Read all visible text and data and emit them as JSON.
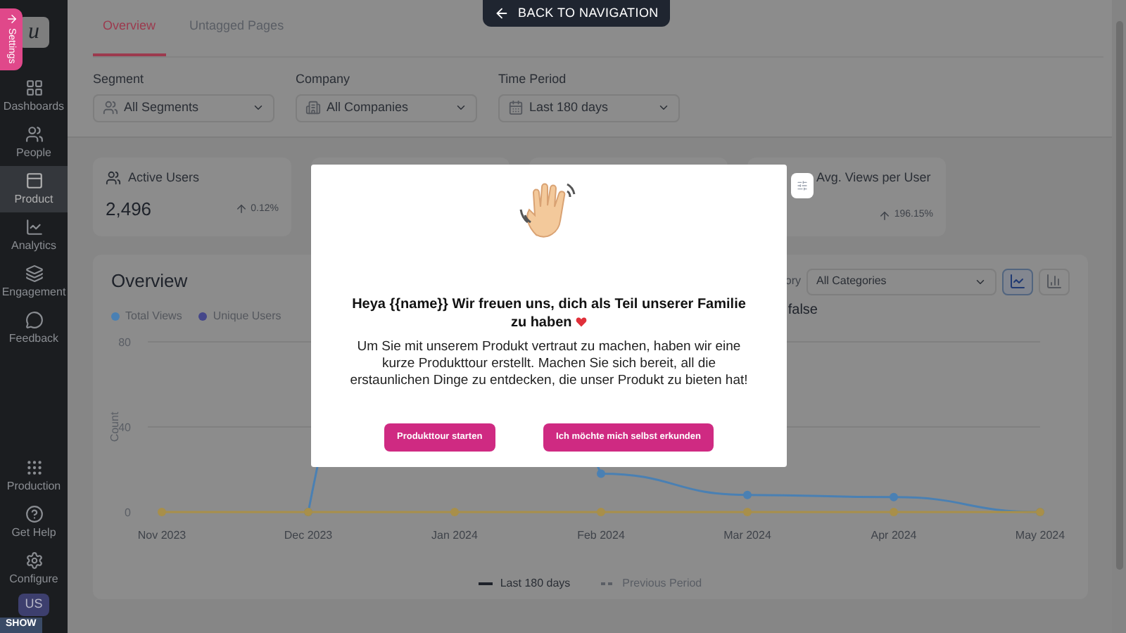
{
  "back_button": {
    "label": "BACK TO NAVIGATION"
  },
  "settings_tab": {
    "label": "Settings"
  },
  "sidebar": {
    "logo": "u",
    "items": [
      {
        "label": "Dashboards",
        "selected": false
      },
      {
        "label": "People",
        "selected": false
      },
      {
        "label": "Product",
        "selected": true
      },
      {
        "label": "Analytics",
        "selected": false
      },
      {
        "label": "Engagement",
        "selected": false
      },
      {
        "label": "Feedback",
        "selected": false
      }
    ],
    "bottom_items": [
      {
        "label": "Production"
      },
      {
        "label": "Get Help"
      },
      {
        "label": "Configure"
      }
    ],
    "avatar": "US",
    "show_badge": "SHOW"
  },
  "tabs": [
    {
      "label": "Overview",
      "selected": true
    },
    {
      "label": "Untagged Pages",
      "selected": false
    }
  ],
  "filters": [
    {
      "label": "Segment",
      "value": "All Segments"
    },
    {
      "label": "Company",
      "value": "All Companies"
    },
    {
      "label": "Time Period",
      "value": "Last 180 days"
    }
  ],
  "metric_cards": [
    {
      "title": "Active Users",
      "value": "2,496",
      "change": "0.12%"
    },
    {
      "title": "Avg. Views per User",
      "change": "196.15%"
    }
  ],
  "overview": {
    "title": "Overview",
    "legend_extra": [
      {
        "label": "Unique Users",
        "color": "#45478a"
      }
    ],
    "category_label": "ory",
    "category_value": "All Categories",
    "flag_text": "false",
    "chart_types": [
      {
        "kind": "line",
        "selected": true
      },
      {
        "kind": "bar",
        "selected": false
      }
    ],
    "chart_data": {
      "type": "line",
      "ylabel": "Count",
      "categories": [
        "Nov 2023",
        "Dec 2023",
        "Jan 2024",
        "Feb 2024",
        "Mar 2024",
        "Apr 2024",
        "May 2024"
      ],
      "ylim": [
        0,
        80
      ],
      "yticks": [
        0,
        40,
        80
      ],
      "series": [
        {
          "name": "Total Views",
          "color": "#4a80b3",
          "marker": "circle",
          "values": [
            null,
            0,
            null,
            18,
            8,
            7,
            0
          ]
        },
        {
          "color": "#a88f4a",
          "marker": "circle",
          "values": [
            0,
            0,
            0,
            0,
            0,
            0,
            0
          ]
        }
      ]
    },
    "period_legend": [
      {
        "label": "Last 180 days",
        "kind": "solid"
      },
      {
        "label": "Previous Period",
        "kind": "dashed"
      }
    ]
  },
  "modal": {
    "heading": "Heya {{name}} Wir freuen uns, dich als Teil unserer Familie zu haben",
    "body": "Um Sie mit unserem Produkt vertraut zu machen, haben wir eine kurze Produkttour erstellt. Machen Sie sich bereit, all die erstaunlichen Dinge zu entdecken, die unser Produkt zu bieten hat!",
    "buttons": [
      {
        "label": "Produkttour starten"
      },
      {
        "label": "Ich möchte mich selbst erkunden"
      }
    ]
  }
}
